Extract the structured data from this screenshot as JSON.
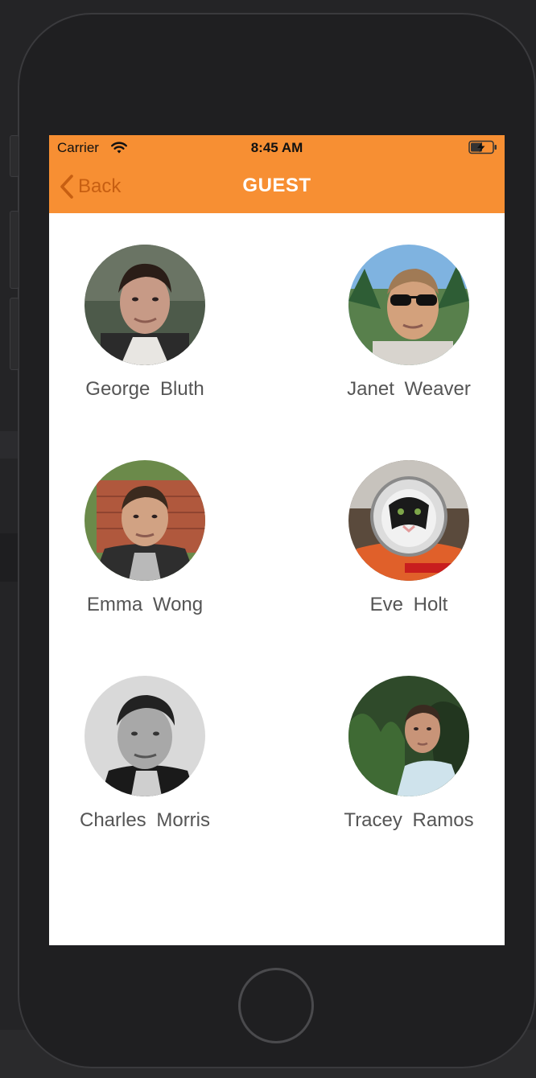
{
  "status_bar": {
    "carrier": "Carrier",
    "time": "8:45 AM",
    "wifi_icon": "wifi-icon",
    "battery_icon": "battery-charging-icon"
  },
  "nav": {
    "back_label": "Back",
    "back_icon": "chevron-left-icon",
    "title": "GUEST",
    "accent_color": "#f78f33"
  },
  "guests": [
    {
      "name": "George  Bluth"
    },
    {
      "name": "Janet  Weaver"
    },
    {
      "name": "Emma  Wong"
    },
    {
      "name": "Eve  Holt"
    },
    {
      "name": "Charles  Morris"
    },
    {
      "name": "Tracey  Ramos"
    }
  ]
}
